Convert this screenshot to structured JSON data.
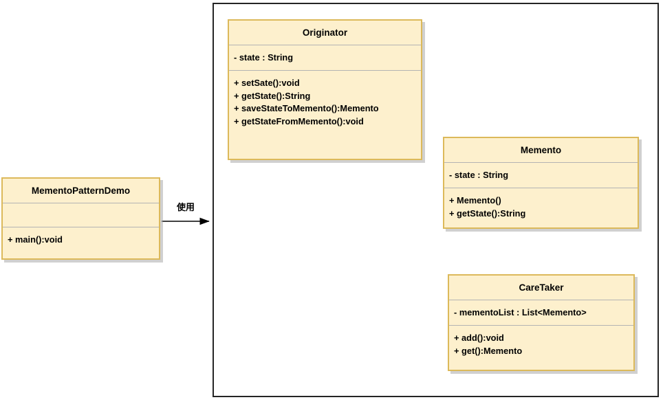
{
  "diagram": {
    "title": "Memento Pattern UML Class Diagram",
    "colors": {
      "class_fill": "#fdf0cd",
      "class_border": "#dcb95a",
      "package_border": "#242424",
      "divider": "#b3b3b3",
      "connector": "#000000",
      "text": "#000000"
    }
  },
  "classes": {
    "demo": {
      "name": "MementoPatternDemo",
      "attributes": [],
      "methods": [
        "+ main():void"
      ]
    },
    "originator": {
      "name": "Originator",
      "attributes": [
        "- state : String"
      ],
      "methods": [
        "+ setSate():void",
        "+ getState():String",
        "+ saveStateToMemento():Memento",
        "+ getStateFromMemento():void"
      ]
    },
    "memento": {
      "name": "Memento",
      "attributes": [
        "- state : String"
      ],
      "methods": [
        "+ Memento()",
        "+ getState():String"
      ]
    },
    "caretaker": {
      "name": "CareTaker",
      "attributes": [
        "- mementoList : List<Memento>"
      ],
      "methods": [
        "+ add():void",
        "+ get():Memento"
      ]
    }
  },
  "connectors": {
    "demo_to_package": {
      "label": "使用",
      "from": "MementoPatternDemo",
      "to": "package",
      "arrow": "filled"
    },
    "originator_to_memento": {
      "label": "",
      "from": "Originator",
      "to": "Memento",
      "arrow": "filled"
    },
    "caretaker_to_memento": {
      "label": "",
      "from": "CareTaker",
      "to": "Memento",
      "arrow": "filled"
    }
  }
}
